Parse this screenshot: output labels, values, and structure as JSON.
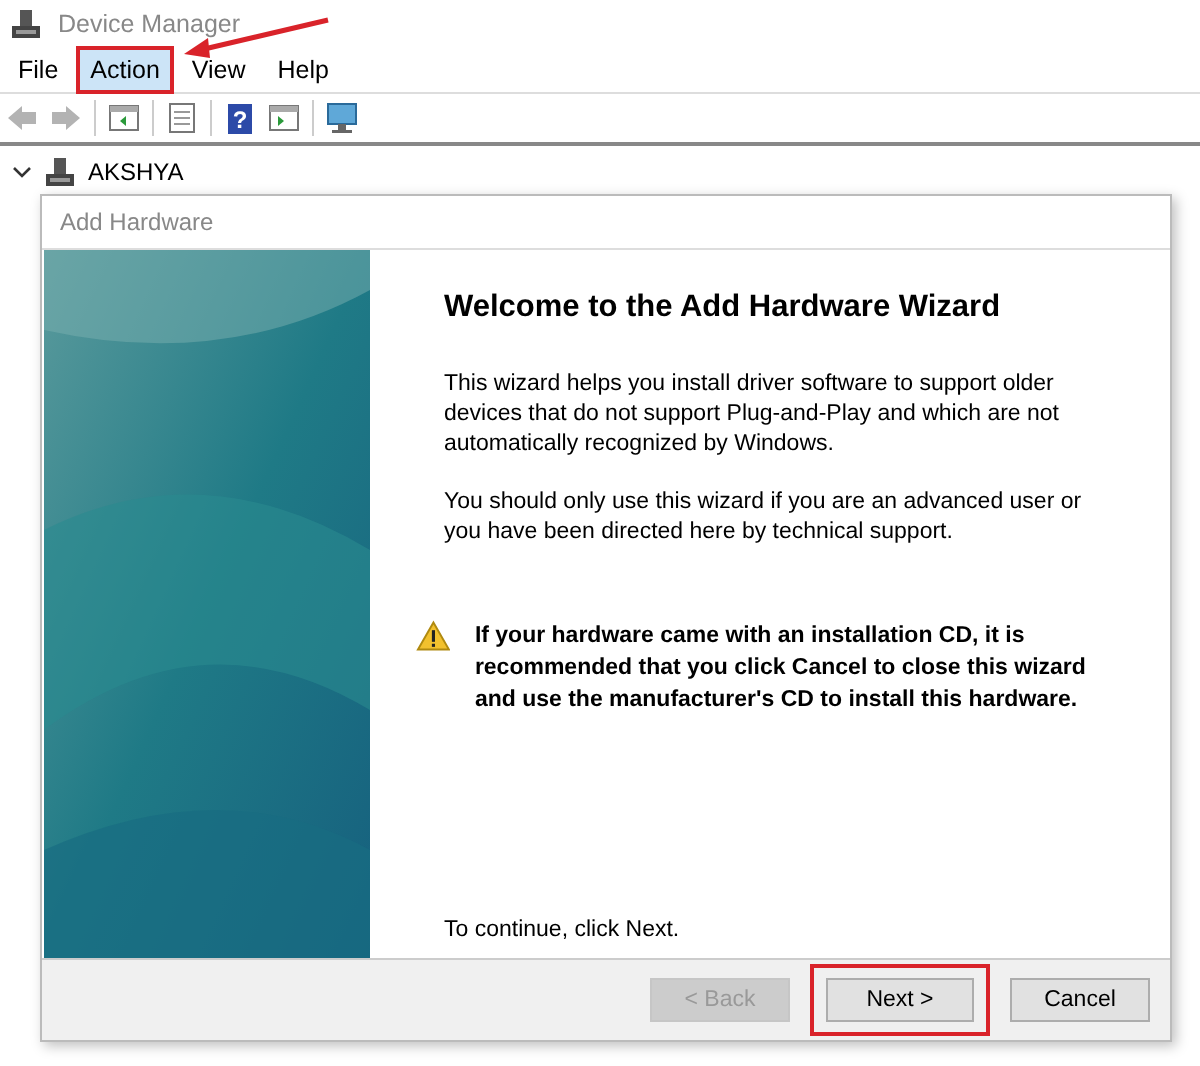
{
  "window": {
    "title": "Device Manager"
  },
  "menu": [
    {
      "label": "File",
      "selected": false,
      "annotated": false
    },
    {
      "label": "Action",
      "selected": true,
      "annotated": true
    },
    {
      "label": "View",
      "selected": false,
      "annotated": false
    },
    {
      "label": "Help",
      "selected": false,
      "annotated": false
    }
  ],
  "toolbar": [
    {
      "kind": "back",
      "disabled": true
    },
    {
      "kind": "forward",
      "disabled": true
    },
    {
      "kind": "sep"
    },
    {
      "kind": "panel"
    },
    {
      "kind": "sep"
    },
    {
      "kind": "properties"
    },
    {
      "kind": "sep"
    },
    {
      "kind": "help",
      "glyph": "?"
    },
    {
      "kind": "panel2"
    },
    {
      "kind": "sep"
    },
    {
      "kind": "monitor"
    }
  ],
  "tree": {
    "label": "AKSHYA",
    "expanded": true
  },
  "dialog": {
    "title": "Add Hardware",
    "heading": "Welcome to the Add Hardware Wizard",
    "paragraphs": [
      "This wizard helps you install driver software to support older devices that do not support Plug-and-Play and which are not automatically recognized by Windows.",
      "You should only use this wizard if you are an advanced user or you have been directed here by technical support."
    ],
    "warning": "If your hardware came with an installation CD, it is recommended that you click Cancel to close this wizard and use the manufacturer's CD to install this hardware.",
    "continue": "To continue, click Next.",
    "buttons": [
      {
        "label": "< Back",
        "disabled": true,
        "annotated": false
      },
      {
        "label": "Next >",
        "disabled": false,
        "annotated": true
      },
      {
        "label": "Cancel",
        "disabled": false,
        "annotated": false
      }
    ]
  }
}
